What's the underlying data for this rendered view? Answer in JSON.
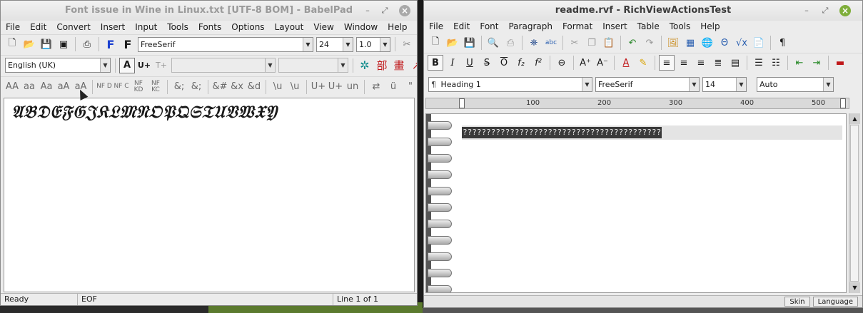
{
  "babelpad": {
    "title": "Font issue in Wine in Linux.txt [UTF-8 BOM] - BabelPad",
    "menu": [
      "File",
      "Edit",
      "Convert",
      "Insert",
      "Input",
      "Tools",
      "Fonts",
      "Options",
      "Layout",
      "View",
      "Window",
      "Help"
    ],
    "font_name": "FreeSerif",
    "font_size": "24",
    "line_spacing": "1.0",
    "language": "English (UK)",
    "u_plus": "U+",
    "t_plus": "T+",
    "toolbar3": {
      "aa1": "AA",
      "aa2": "aa",
      "aa3": "Aa",
      "aa4": "aA",
      "aa5": "aA",
      "nfd": "NF D",
      "nfc": "NF C",
      "nfkd": "NF KD",
      "nfkc": "NF KC",
      "amp1": "&;",
      "amp2": "&;",
      "amp3": "&#",
      "amp4": "&x",
      "amp5": "&d",
      "u1": "\\u",
      "u2": "\\u",
      "u3": "U+",
      "u4": "U+",
      "u5": "un",
      "arr": "⇄",
      "u8": "ü",
      "quo": "\"",
      "acc": "A"
    },
    "document_text": "𝔄𝔅𝔇𝔈𝔉𝔊𝔍𝔎𝔏𝔐𝔑𝔒𝔓𝔔𝔖𝔗𝔘𝔙𝔚𝔛𝔜",
    "status": {
      "ready": "Ready",
      "eof": "EOF",
      "line": "Line 1 of 1"
    }
  },
  "richview": {
    "title": "readme.rvf - RichViewActionsTest",
    "menu": [
      "File",
      "Edit",
      "Font",
      "Paragraph",
      "Format",
      "Insert",
      "Table",
      "Tools",
      "Help"
    ],
    "style": "Heading 1",
    "font_name": "FreeSerif",
    "font_size": "14",
    "spacing": "Auto",
    "ruler": [
      "100",
      "200",
      "300",
      "400",
      "500"
    ],
    "document_text": "??????????????????????????????????????????",
    "status": {
      "skin": "Skin",
      "language": "Language"
    }
  },
  "colors": {
    "accent_green": "#7fae3a",
    "desktop_green": "#5b7a2e",
    "bold_blue": "#1a3fd0"
  }
}
